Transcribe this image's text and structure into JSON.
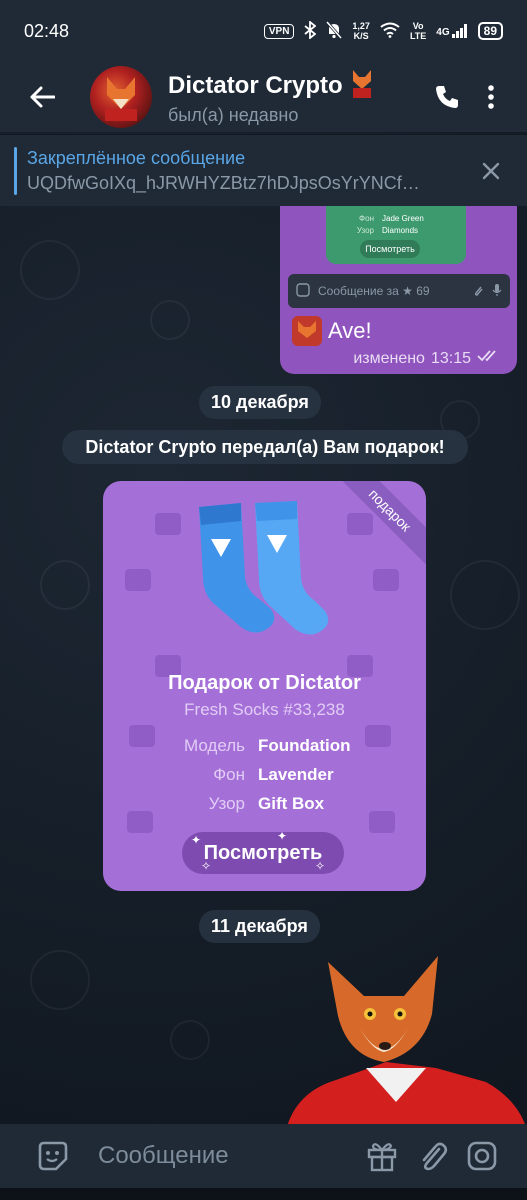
{
  "status_bar": {
    "time": "02:48",
    "vpn": "VPN",
    "speed_value": "1,27",
    "speed_unit": "K/S",
    "volte_top": "Vo",
    "volte_bottom": "LTE",
    "network": "4G",
    "battery": "89"
  },
  "header": {
    "name": "Dictator Crypto",
    "status": "был(а) недавно"
  },
  "pinned": {
    "title": "Закреплённое сообщение",
    "text": "UQDfwGoIXq_hJRWHYZBtz7hDJpsOsYrYNCf…"
  },
  "outgoing": {
    "card_rows": [
      {
        "key": "Фон",
        "value": "Jade Green"
      },
      {
        "key": "Узор",
        "value": "Diamonds"
      }
    ],
    "card_button": "Посмотреть",
    "input_placeholder": "Сообщение за",
    "input_star_price": "★ 69",
    "text": "Ave!",
    "edited_label": "изменено",
    "time": "13:15"
  },
  "date_1": "10 декабря",
  "service_message": "Dictator Crypto передал(а) Вам подарок!",
  "gift": {
    "ribbon": "подарок",
    "title": "Подарок от Dictator",
    "subtitle": "Fresh Socks #33,238",
    "attributes": [
      {
        "key": "Модель",
        "value": "Foundation"
      },
      {
        "key": "Фон",
        "value": "Lavender"
      },
      {
        "key": "Узор",
        "value": "Gift Box"
      }
    ],
    "button": "Посмотреть"
  },
  "date_2": "11 декабря",
  "composer": {
    "placeholder": "Сообщение"
  },
  "colors": {
    "accent": "#5aa6e6",
    "outgoing_bubble": "#8f54bd",
    "gift_background": "#a470d8",
    "chat_bar": "#1f2a36"
  }
}
